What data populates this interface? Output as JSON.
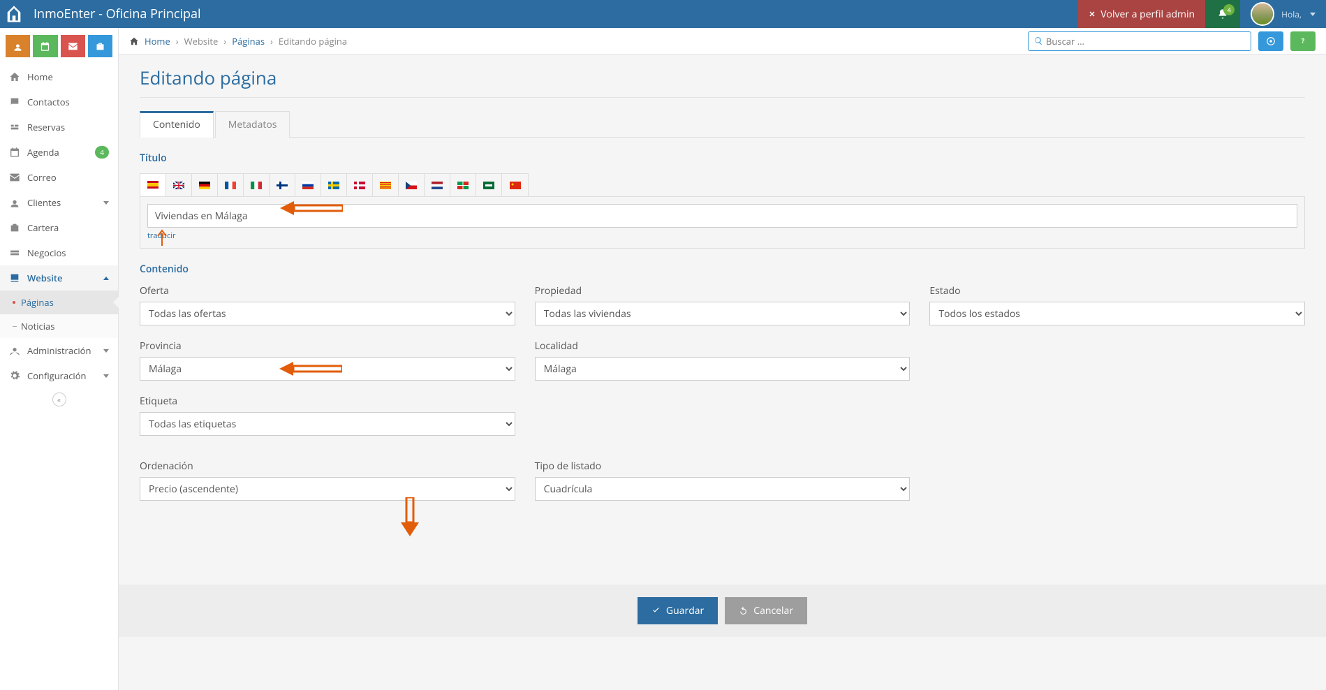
{
  "app_title": "InmoEnter - Oficina Principal",
  "admin_return": "Volver a perfil admin",
  "notif_count": "4",
  "greeting": "Hola,",
  "breadcrumb": {
    "home": "Home",
    "website": "Website",
    "paginas": "Páginas",
    "editando": "Editando página"
  },
  "search_placeholder": "Buscar ...",
  "sidebar": {
    "home": "Home",
    "contactos": "Contactos",
    "reservas": "Reservas",
    "agenda": "Agenda",
    "agenda_badge": "4",
    "correo": "Correo",
    "clientes": "Clientes",
    "cartera": "Cartera",
    "negocios": "Negocios",
    "website": "Website",
    "paginas": "Páginas",
    "noticias": "Noticias",
    "admin": "Administración",
    "config": "Configuración"
  },
  "page_heading": "Editando página",
  "tabs": {
    "contenido": "Contenido",
    "metadatos": "Metadatos"
  },
  "section": {
    "titulo": "Título",
    "contenido": "Contenido"
  },
  "title_value": "Viviendas en Málaga",
  "traducir": "traducir",
  "fields": {
    "oferta": {
      "label": "Oferta",
      "value": "Todas las ofertas"
    },
    "propiedad": {
      "label": "Propiedad",
      "value": "Todas las viviendas"
    },
    "estado": {
      "label": "Estado",
      "value": "Todos los estados"
    },
    "provincia": {
      "label": "Provincia",
      "value": "Málaga"
    },
    "localidad": {
      "label": "Localidad",
      "value": "Málaga"
    },
    "etiqueta": {
      "label": "Etiqueta",
      "value": "Todas las etiquetas"
    },
    "ordenacion": {
      "label": "Ordenación",
      "value": "Precio (ascendente)"
    },
    "listado": {
      "label": "Tipo de listado",
      "value": "Cuadrícula"
    }
  },
  "buttons": {
    "guardar": "Guardar",
    "cancelar": "Cancelar"
  }
}
